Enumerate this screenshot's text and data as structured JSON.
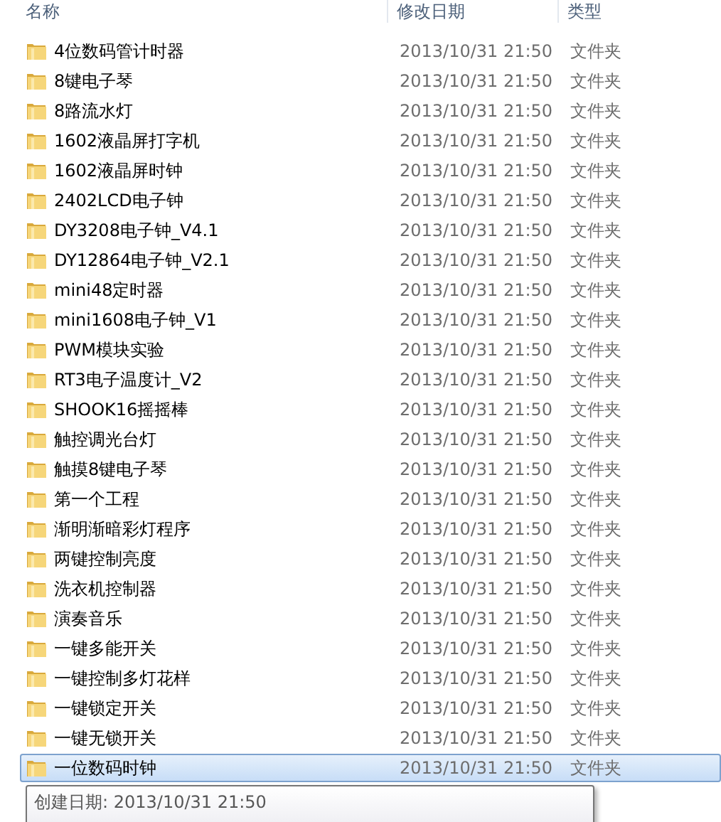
{
  "columns": [
    "名称",
    "修改日期",
    "类型"
  ],
  "rows": [
    {
      "name": "4位数码管计时器",
      "date": "2013/10/31 21:50",
      "type": "文件夹",
      "selected": false
    },
    {
      "name": "8键电子琴",
      "date": "2013/10/31 21:50",
      "type": "文件夹",
      "selected": false
    },
    {
      "name": "8路流水灯",
      "date": "2013/10/31 21:50",
      "type": "文件夹",
      "selected": false
    },
    {
      "name": "1602液晶屏打字机",
      "date": "2013/10/31 21:50",
      "type": "文件夹",
      "selected": false
    },
    {
      "name": "1602液晶屏时钟",
      "date": "2013/10/31 21:50",
      "type": "文件夹",
      "selected": false
    },
    {
      "name": "2402LCD电子钟",
      "date": "2013/10/31 21:50",
      "type": "文件夹",
      "selected": false
    },
    {
      "name": "DY3208电子钟_V4.1",
      "date": "2013/10/31 21:50",
      "type": "文件夹",
      "selected": false
    },
    {
      "name": "DY12864电子钟_V2.1",
      "date": "2013/10/31 21:50",
      "type": "文件夹",
      "selected": false
    },
    {
      "name": "mini48定时器",
      "date": "2013/10/31 21:50",
      "type": "文件夹",
      "selected": false
    },
    {
      "name": "mini1608电子钟_V1",
      "date": "2013/10/31 21:50",
      "type": "文件夹",
      "selected": false
    },
    {
      "name": "PWM模块实验",
      "date": "2013/10/31 21:50",
      "type": "文件夹",
      "selected": false
    },
    {
      "name": "RT3电子温度计_V2",
      "date": "2013/10/31 21:50",
      "type": "文件夹",
      "selected": false
    },
    {
      "name": "SHOOK16摇摇棒",
      "date": "2013/10/31 21:50",
      "type": "文件夹",
      "selected": false
    },
    {
      "name": "触控调光台灯",
      "date": "2013/10/31 21:50",
      "type": "文件夹",
      "selected": false
    },
    {
      "name": "触摸8键电子琴",
      "date": "2013/10/31 21:50",
      "type": "文件夹",
      "selected": false
    },
    {
      "name": "第一个工程",
      "date": "2013/10/31 21:50",
      "type": "文件夹",
      "selected": false
    },
    {
      "name": "渐明渐暗彩灯程序",
      "date": "2013/10/31 21:50",
      "type": "文件夹",
      "selected": false
    },
    {
      "name": "两键控制亮度",
      "date": "2013/10/31 21:50",
      "type": "文件夹",
      "selected": false
    },
    {
      "name": "洗衣机控制器",
      "date": "2013/10/31 21:50",
      "type": "文件夹",
      "selected": false
    },
    {
      "name": "演奏音乐",
      "date": "2013/10/31 21:50",
      "type": "文件夹",
      "selected": false
    },
    {
      "name": "一键多能开关",
      "date": "2013/10/31 21:50",
      "type": "文件夹",
      "selected": false
    },
    {
      "name": "一键控制多灯花样",
      "date": "2013/10/31 21:50",
      "type": "文件夹",
      "selected": false
    },
    {
      "name": "一键锁定开关",
      "date": "2013/10/31 21:50",
      "type": "文件夹",
      "selected": false
    },
    {
      "name": "一键无锁开关",
      "date": "2013/10/31 21:50",
      "type": "文件夹",
      "selected": false
    },
    {
      "name": "一位数码时钟",
      "date": "2013/10/31 21:50",
      "type": "文件夹",
      "selected": true
    }
  ],
  "tooltip": {
    "text": "创建日期: 2013/10/31 21:50"
  }
}
